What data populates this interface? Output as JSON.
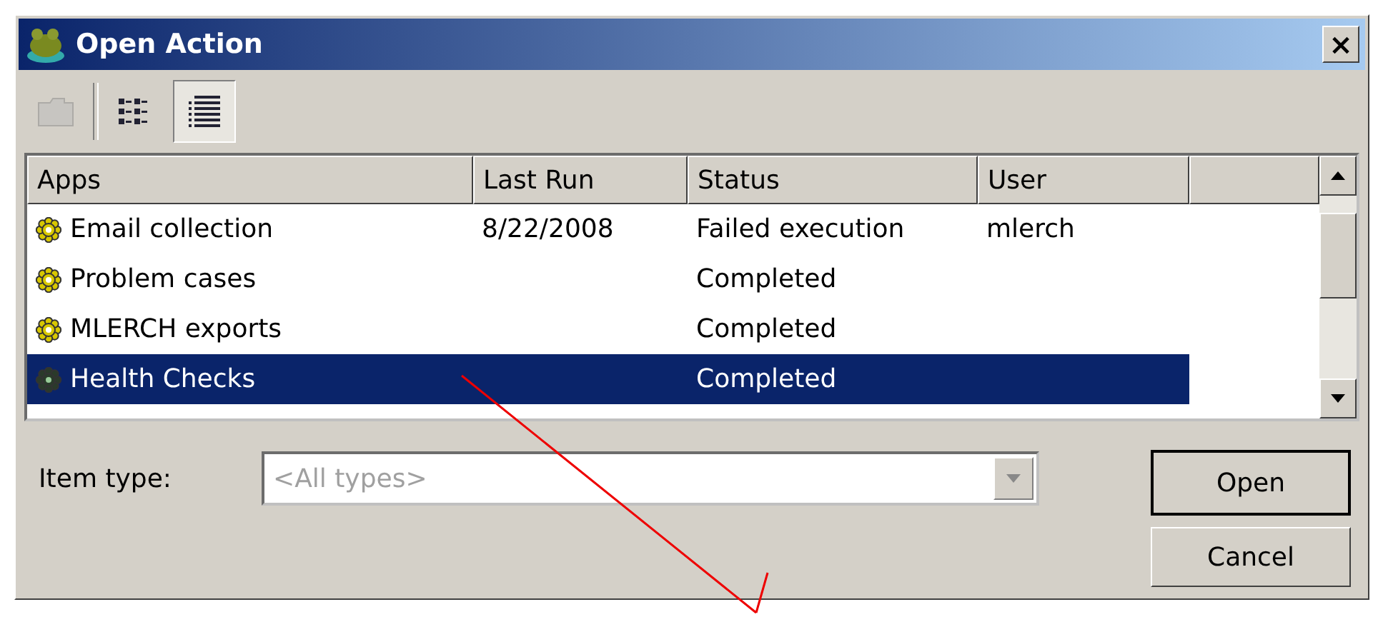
{
  "window": {
    "title": "Open Action",
    "close": "×"
  },
  "toolbar": [
    {
      "kind": "folder",
      "selected": false,
      "disabled": true
    },
    {
      "kind": "list",
      "selected": false,
      "disabled": false
    },
    {
      "kind": "details",
      "selected": true,
      "disabled": false
    }
  ],
  "table": {
    "columns": [
      "Apps",
      "Last Run",
      "Status",
      "User"
    ],
    "rows": [
      {
        "cells": [
          "Email collection",
          "8/22/2008",
          "Failed execution",
          "mlerch"
        ],
        "selected": false
      },
      {
        "cells": [
          "Problem cases",
          "",
          "Completed",
          ""
        ],
        "selected": false
      },
      {
        "cells": [
          "MLERCH exports",
          "",
          "Completed",
          ""
        ],
        "selected": false
      },
      {
        "cells": [
          "Health Checks",
          "",
          "Completed",
          ""
        ],
        "selected": true
      }
    ]
  },
  "item_type": {
    "label": "Item type:",
    "placeholder": "<All types>",
    "disabled": true
  },
  "buttons": [
    {
      "label": "Open",
      "default": true
    },
    {
      "label": "Cancel",
      "default": false
    }
  ]
}
